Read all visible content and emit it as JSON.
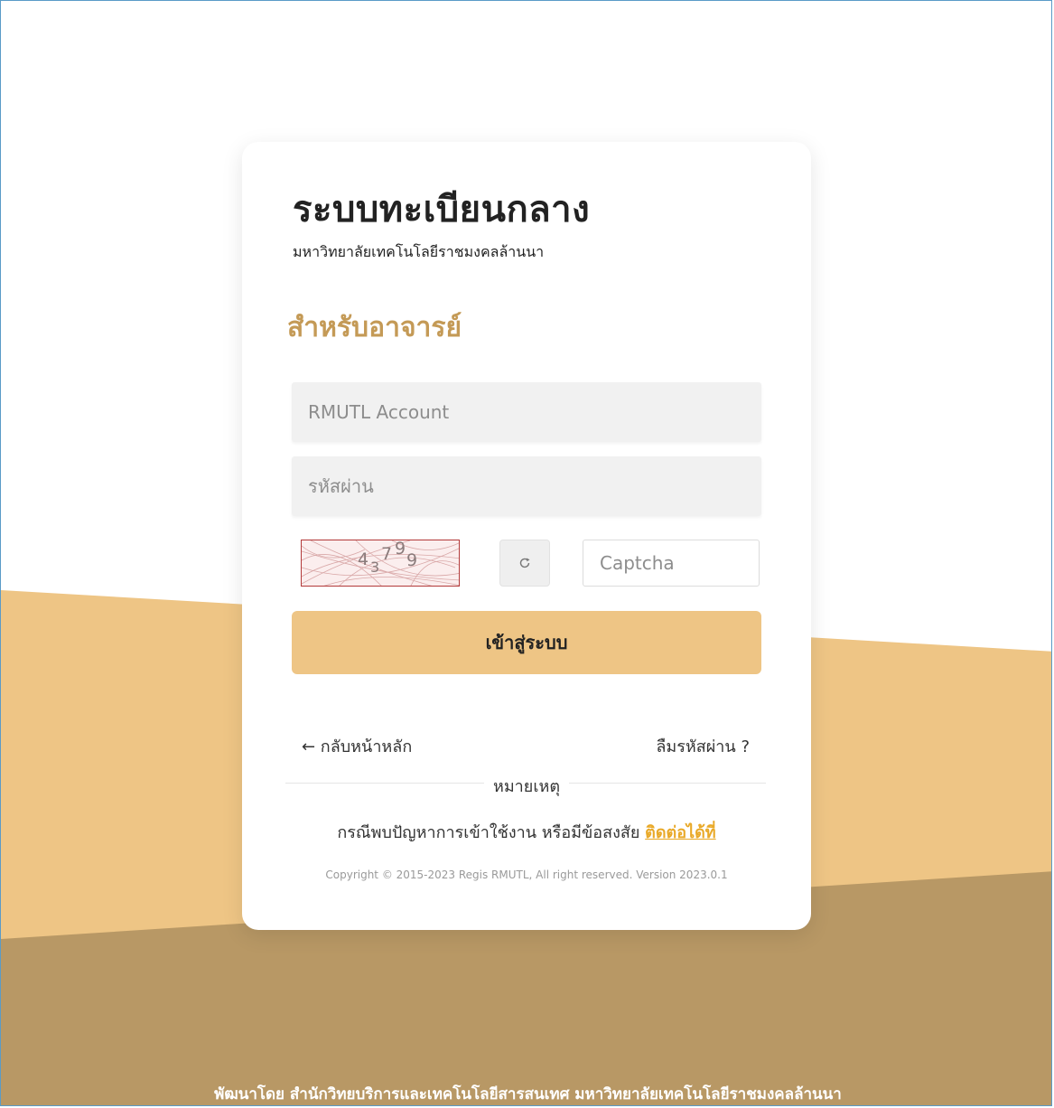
{
  "header": {
    "system_title": "ระบบทะเบียนกลาง",
    "university_name": "มหาวิทยาลัยเทคโนโลยีราชมงคลล้านนา"
  },
  "login": {
    "role_heading": "สำหรับอาจารย์",
    "account_placeholder": "RMUTL Account",
    "password_placeholder": "รหัสผ่าน",
    "captcha_digits": [
      "4",
      "3",
      "7",
      "9",
      "9"
    ],
    "captcha_placeholder": "Captcha",
    "refresh_icon": "refresh-icon",
    "login_button_label": "เข้าสู่ระบบ",
    "back_link_label": "← กลับหน้าหลัก",
    "forgot_password_label": "ลืมรหัสผ่าน ?"
  },
  "remark": {
    "label": "หมายเหตุ",
    "text": "กรณีพบปัญหาการเข้าใช้งาน หรือมีข้อสงสัย",
    "contact_link": "ติดต่อได้ที่"
  },
  "copyright": "Copyright © 2015-2023 Regis RMUTL, All right reserved. Version 2023.0.1",
  "footer": {
    "credit": "พัฒนาโดย สำนักวิทยบริการและเทคโนโลยีสารสนเทศ มหาวิทยาลัยเทคโนโลยีราชมงคลล้านนา"
  },
  "colors": {
    "accent_light": "#eec585",
    "accent_dark": "#b89865",
    "heading_gold": "#c49a56",
    "link_orange": "#e9a928"
  }
}
